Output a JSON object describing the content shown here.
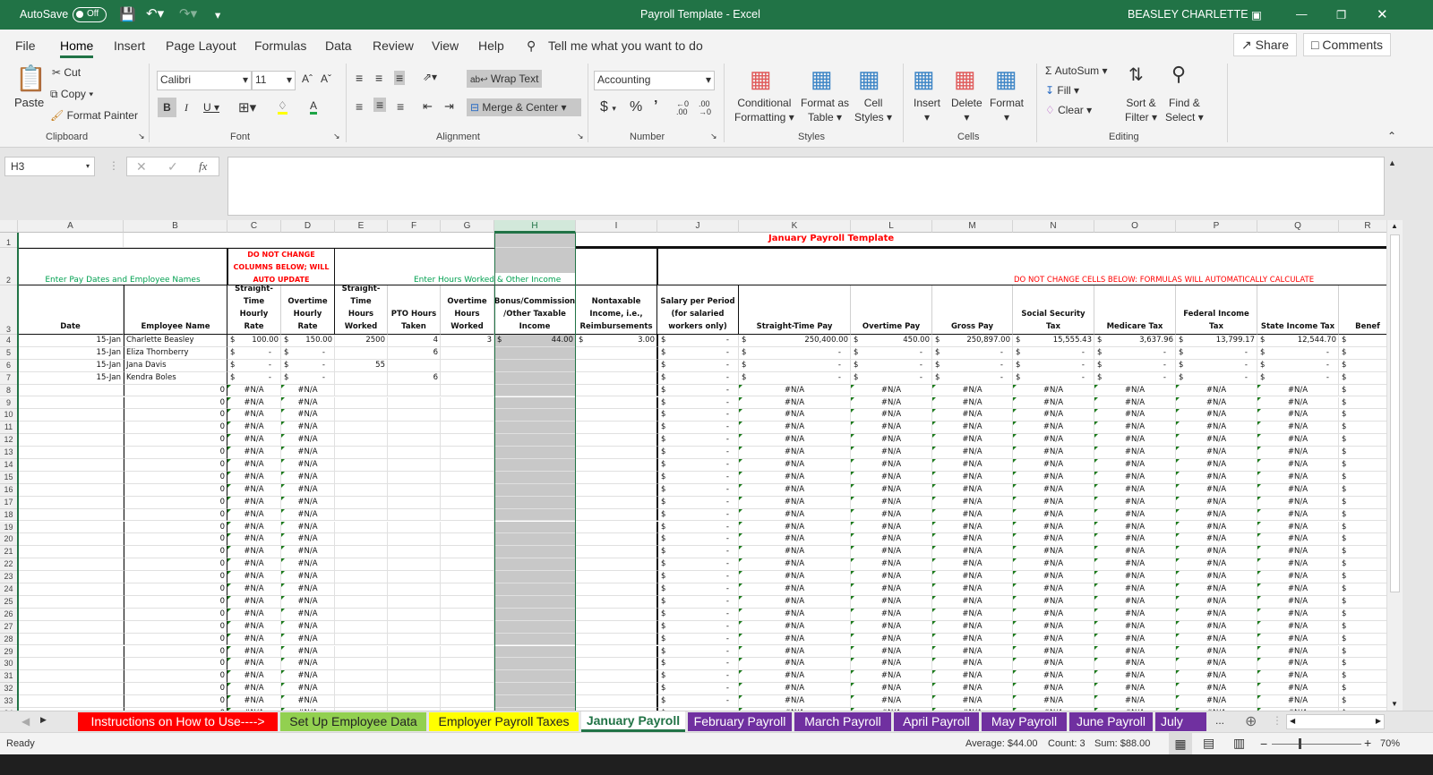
{
  "titlebar": {
    "autosave_label": "AutoSave",
    "autosave_state": "Off",
    "title": "Payroll Template  -  Excel",
    "user": "BEASLEY CHARLETTE"
  },
  "menu": {
    "items": [
      "File",
      "Home",
      "Insert",
      "Page Layout",
      "Formulas",
      "Data",
      "Review",
      "View",
      "Help"
    ],
    "tell_me": "Tell me what you want to do",
    "share": "Share",
    "comments": "Comments"
  },
  "ribbon": {
    "clipboard": {
      "paste": "Paste",
      "cut": "Cut",
      "copy": "Copy",
      "format_painter": "Format Painter",
      "label": "Clipboard"
    },
    "font": {
      "name": "Calibri",
      "size": "11",
      "label": "Font"
    },
    "alignment": {
      "wrap_text": "Wrap Text",
      "merge_center": "Merge & Center",
      "label": "Alignment"
    },
    "number": {
      "format": "Accounting",
      "label": "Number"
    },
    "styles": {
      "conditional": "Conditional",
      "formatting": "Formatting",
      "format_as": "Format as",
      "table": "Table",
      "cell": "Cell",
      "cell_styles": "Styles",
      "label": "Styles"
    },
    "cells": {
      "insert": "Insert",
      "delete": "Delete",
      "format": "Format",
      "label": "Cells"
    },
    "editing": {
      "autosum": "AutoSum",
      "fill": "Fill",
      "clear": "Clear",
      "sort": "Sort &",
      "filter": "Filter",
      "find": "Find &",
      "select": "Select",
      "label": "Editing"
    }
  },
  "formula_bar": {
    "name_box": "H3",
    "formula": ""
  },
  "sheet": {
    "columns": [
      "A",
      "B",
      "C",
      "D",
      "E",
      "F",
      "G",
      "H",
      "I",
      "J",
      "K",
      "L",
      "M",
      "N",
      "O",
      "P",
      "Q",
      "R"
    ],
    "selected_column": "H",
    "title": "January Payroll Template",
    "section_left": "Enter Pay Dates and Employee Names",
    "section_warning": "DO NOT CHANGE COLUMNS BELOW; WILL AUTO UPDATE",
    "section_hours": "Enter Hours Worked & Other Income",
    "section_formulas": "DO NOT CHANGE CELLS BELOW: FORMULAS WILL AUTOMATICALLY CALCULATE",
    "headers": [
      "Date",
      "Employee Name",
      "Straight-Time Hourly Rate",
      "Overtime Hourly Rate",
      "Straight-Time Hours Worked",
      "PTO Hours Taken",
      "Overtime Hours Worked",
      "Bonus/Commission /Other Taxable Income",
      "Nontaxable Income, i.e., Reimbursements",
      "Salary per Period (for salaried workers only)",
      "Straight-Time Pay",
      "Overtime Pay",
      "Gross Pay",
      "Social Security Tax",
      "Medicare Tax",
      "Federal Income Tax",
      "State Income Tax",
      "Benef"
    ],
    "employees": [
      {
        "date": "15-Jan",
        "name": "Charlette Beasley",
        "st_rate": "100.00",
        "ot_rate": "150.00",
        "st_hours": "2500",
        "pto": "4",
        "ot_hours": "3",
        "bonus": "44.00",
        "nontax": "3.00",
        "salary": "-",
        "st_pay": "250,400.00",
        "ot_pay": "450.00",
        "gross": "250,897.00",
        "ss": "15,555.43",
        "medicare": "3,637.96",
        "federal": "13,799.17",
        "state": "12,544.70"
      },
      {
        "date": "15-Jan",
        "name": "Eliza Thornberry",
        "st_rate": "-",
        "ot_rate": "-",
        "st_hours": "",
        "pto": "6",
        "ot_hours": "",
        "bonus": "",
        "nontax": "",
        "salary": "-",
        "st_pay": "-",
        "ot_pay": "-",
        "gross": "-",
        "ss": "-",
        "medicare": "-",
        "federal": "-",
        "state": "-"
      },
      {
        "date": "15-Jan",
        "name": "Jana Davis",
        "st_rate": "-",
        "ot_rate": "-",
        "st_hours": "55",
        "pto": "",
        "ot_hours": "",
        "bonus": "",
        "nontax": "",
        "salary": "-",
        "st_pay": "-",
        "ot_pay": "-",
        "gross": "-",
        "ss": "-",
        "medicare": "-",
        "federal": "-",
        "state": "-"
      },
      {
        "date": "15-Jan",
        "name": "Kendra Boles",
        "st_rate": "-",
        "ot_rate": "-",
        "st_hours": "",
        "pto": "6",
        "ot_hours": "",
        "bonus": "",
        "nontax": "",
        "salary": "-",
        "st_pay": "-",
        "ot_pay": "-",
        "gross": "-",
        "ss": "-",
        "medicare": "-",
        "federal": "-",
        "state": "-"
      }
    ],
    "empty_row": {
      "b": "0",
      "na": "#N/A",
      "salary": "-",
      "currency": "$"
    },
    "currency_symbol": "$",
    "first_row": 1,
    "last_row": 33
  },
  "sheet_tabs": [
    {
      "label": "Instructions on How to Use---->",
      "color": "#ff0000",
      "text": "#ffffff"
    },
    {
      "label": "Set Up Employee Data",
      "color": "#92d050",
      "text": "#222222"
    },
    {
      "label": "Employer Payroll Taxes",
      "color": "#ffff00",
      "text": "#222222"
    },
    {
      "label": "January Payroll",
      "color": "#ffffff",
      "text": "#217346",
      "active": true
    },
    {
      "label": "February Payroll",
      "color": "#7030a0",
      "text": "#ffffff"
    },
    {
      "label": "March Payroll",
      "color": "#7030a0",
      "text": "#ffffff"
    },
    {
      "label": "April Payroll",
      "color": "#7030a0",
      "text": "#ffffff"
    },
    {
      "label": "May Payroll",
      "color": "#7030a0",
      "text": "#ffffff"
    },
    {
      "label": "June Payroll",
      "color": "#7030a0",
      "text": "#ffffff"
    },
    {
      "label": "July Pay",
      "color": "#7030a0",
      "text": "#ffffff"
    }
  ],
  "status": {
    "mode": "Ready",
    "average": "Average: $44.00",
    "count": "Count: 3",
    "sum": "Sum: $88.00",
    "zoom": "70%"
  },
  "colors": {
    "excel_green": "#217346",
    "warning_red": "#ff0000",
    "section_green": "#00b050",
    "selection_grey": "#c8c8c8"
  }
}
